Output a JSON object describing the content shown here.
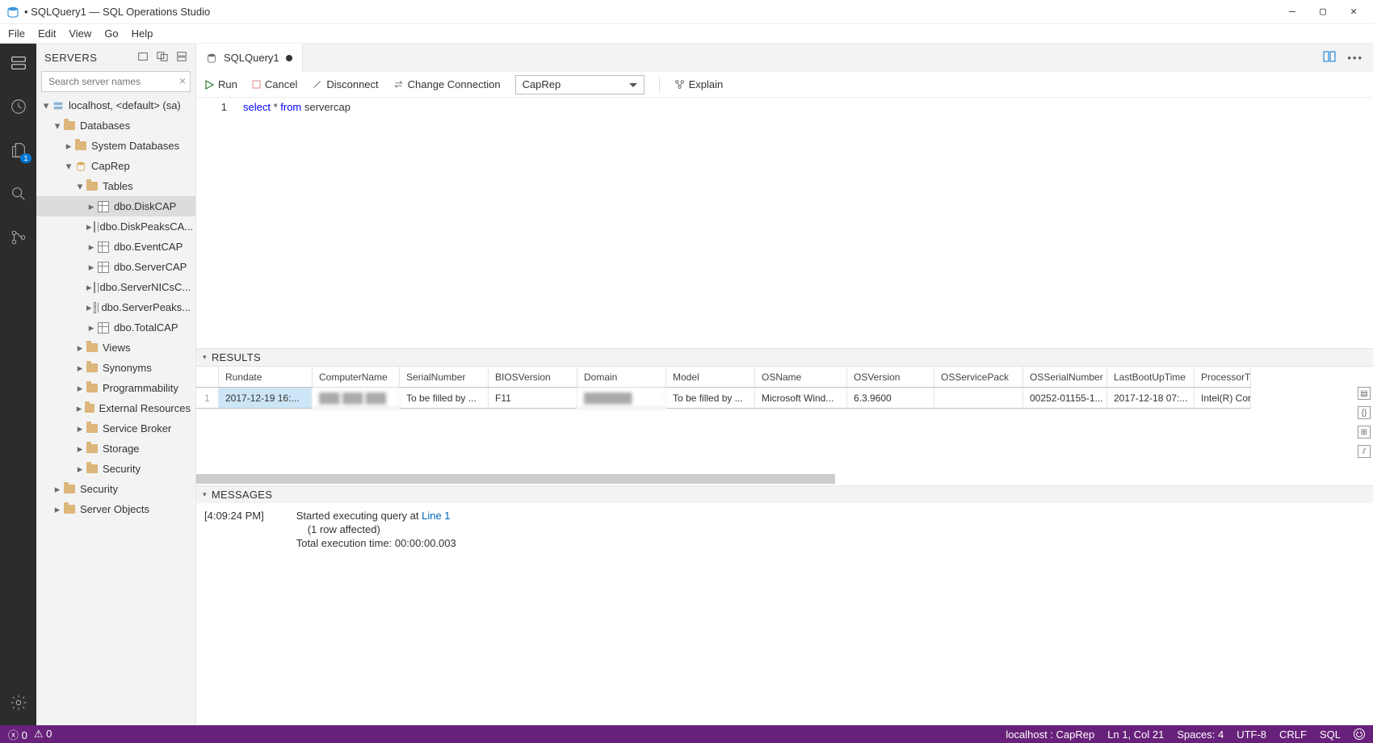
{
  "window": {
    "title": "• SQLQuery1 — SQL Operations Studio"
  },
  "menu": {
    "file": "File",
    "edit": "Edit",
    "view": "View",
    "go": "Go",
    "help": "Help"
  },
  "activity": {
    "badge": "1"
  },
  "sidebar": {
    "title": "SERVERS",
    "search_placeholder": "Search server names",
    "server": "localhost, <default> (sa)",
    "nodes": {
      "databases": "Databases",
      "system_databases": "System Databases",
      "caprep": "CapRep",
      "tables": "Tables",
      "t0": "dbo.DiskCAP",
      "t1": "dbo.DiskPeaksCA...",
      "t2": "dbo.EventCAP",
      "t3": "dbo.ServerCAP",
      "t4": "dbo.ServerNICsC...",
      "t5": "dbo.ServerPeaks...",
      "t6": "dbo.TotalCAP",
      "views": "Views",
      "synonyms": "Synonyms",
      "programmability": "Programmability",
      "external_resources": "External Resources",
      "service_broker": "Service Broker",
      "storage": "Storage",
      "security_db": "Security",
      "security": "Security",
      "server_objects": "Server Objects"
    }
  },
  "tabs": {
    "tab1": "SQLQuery1"
  },
  "toolbar": {
    "run": "Run",
    "cancel": "Cancel",
    "disconnect": "Disconnect",
    "change_connection": "Change Connection",
    "database": "CapRep",
    "explain": "Explain"
  },
  "editor": {
    "line_no": "1",
    "kw_select": "select",
    "kw_star_from": " * ",
    "kw_from": "from",
    "rest": " servercap"
  },
  "panels": {
    "results": "RESULTS",
    "messages": "MESSAGES"
  },
  "grid": {
    "headers": [
      "",
      "Rundate",
      "ComputerName",
      "SerialNumber",
      "BIOSVersion",
      "Domain",
      "Model",
      "OSName",
      "OSVersion",
      "OSServicePack",
      "OSSerialNumber",
      "LastBootUpTime",
      "ProcessorTy"
    ],
    "row": [
      "1",
      "2017-12-19 16:...",
      "███ ███ ███",
      "To be filled by ...",
      "F11",
      "███████",
      "To be filled by ...",
      "Microsoft Wind...",
      "6.3.9600",
      "",
      "00252-01155-1...",
      "2017-12-18 07:...",
      "Intel(R) Cor"
    ]
  },
  "messages": {
    "time": "[4:09:24 PM]",
    "l1a": "Started executing query at ",
    "l1b": "Line 1",
    "l2": "(1 row affected)",
    "l3": "Total execution time: 00:00:00.003"
  },
  "status": {
    "errors": "0",
    "warnings": "0",
    "connection": "localhost : CapRep",
    "cursor": "Ln 1, Col 21",
    "spaces": "Spaces: 4",
    "encoding": "UTF-8",
    "eol": "CRLF",
    "lang": "SQL"
  }
}
